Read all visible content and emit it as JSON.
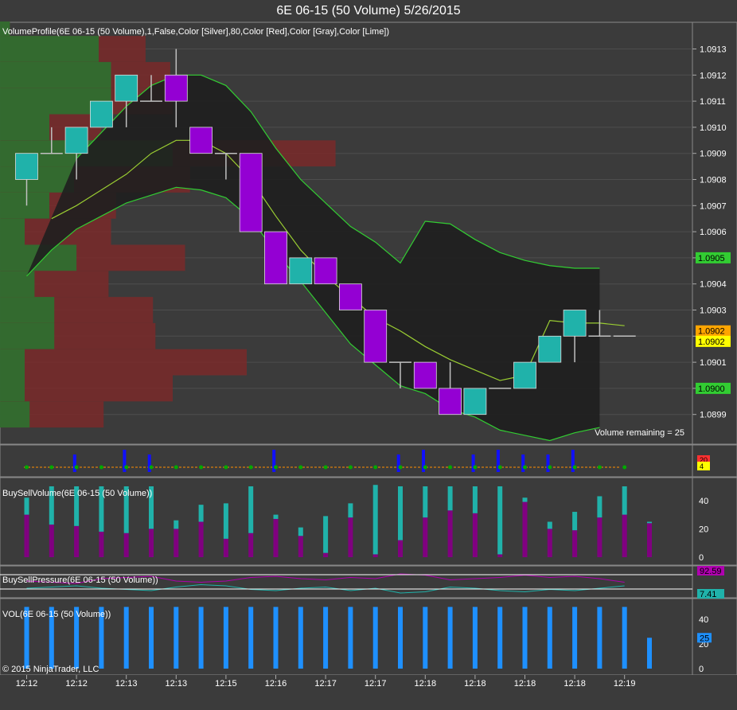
{
  "window_title": "6E 06-15 (50 Volume)  5/26/2015",
  "copyright": "© 2015 NinjaTrader, LLC",
  "colors": {
    "background": "#3b3b3b",
    "up_bar": "#20b2aa",
    "down_bar": "#9400d3",
    "wick": "#c0c0c0",
    "band_fill": "#1f1f1f",
    "band_line": "#32cd32",
    "profile_buy": "#2f6e2f",
    "profile_sell": "#7a2a2a",
    "buy_volume": "#20b2aa",
    "sell_volume": "#800080",
    "vol_bar": "#1e90ff",
    "pressure_buy": "#20b2aa",
    "pressure_sell": "#b000b0"
  },
  "chart_data": [
    {
      "type": "candlestick",
      "indicator_label": "VolumeProfile(6E 06-15 (50 Volume),1,False,Color [Silver],80,Color [Red],Color [Gray],Color [Lime])",
      "note": "Volume remaining = 25",
      "x": [
        "12:12",
        "12:12",
        "12:12",
        "12:13",
        "12:13",
        "12:13",
        "12:15",
        "12:15",
        "12:16",
        "12:16",
        "12:17",
        "12:17",
        "12:17",
        "12:17",
        "12:18",
        "12:18",
        "12:18",
        "12:18",
        "12:18",
        "12:18",
        "12:18",
        "12:18",
        "12:19",
        "12:19",
        "12:19"
      ],
      "x_tick_labels": [
        "12:12",
        "12:12",
        "12:13",
        "12:13",
        "12:15",
        "12:16",
        "12:17",
        "12:17",
        "12:18",
        "12:18",
        "12:18",
        "12:18",
        "12:19"
      ],
      "open": [
        1.0908,
        1.0909,
        1.0909,
        1.091,
        1.0911,
        1.0911,
        1.0912,
        1.091,
        1.0909,
        1.0909,
        1.0906,
        1.0904,
        1.0905,
        1.0904,
        1.0903,
        1.0901,
        1.0901,
        1.09,
        1.0899,
        1.09,
        1.09,
        1.0901,
        1.0902,
        1.0902,
        1.0902
      ],
      "high": [
        1.0909,
        1.091,
        1.091,
        1.0911,
        1.0912,
        1.0912,
        1.0913,
        1.091,
        1.0909,
        1.0909,
        1.0906,
        1.0905,
        1.0905,
        1.0904,
        1.0903,
        1.0901,
        1.0901,
        1.0901,
        1.09,
        1.09,
        1.0901,
        1.0902,
        1.0903,
        1.0903,
        1.0902
      ],
      "low": [
        1.0907,
        1.0909,
        1.0908,
        1.091,
        1.091,
        1.0911,
        1.091,
        1.0909,
        1.0908,
        1.0906,
        1.0904,
        1.0904,
        1.0904,
        1.0903,
        1.0901,
        1.09,
        1.09,
        1.0899,
        1.0899,
        1.09,
        1.09,
        1.0901,
        1.0901,
        1.0902,
        1.0902
      ],
      "close": [
        1.0909,
        1.0909,
        1.091,
        1.0911,
        1.0912,
        1.0911,
        1.0911,
        1.0909,
        1.0909,
        1.0906,
        1.0904,
        1.0905,
        1.0904,
        1.0903,
        1.0901,
        1.0901,
        1.09,
        1.0899,
        1.09,
        1.09,
        1.0901,
        1.0902,
        1.0903,
        1.0902,
        1.0902
      ],
      "band_upper": [
        null,
        null,
        1.09088,
        1.09098,
        1.09108,
        1.09116,
        1.0912,
        1.0912,
        1.09116,
        1.09106,
        1.09092,
        1.0908,
        1.09071,
        1.09062,
        1.09056,
        1.09048,
        1.09064,
        1.09063,
        1.09057,
        1.09052,
        1.09049,
        1.09047,
        1.09046,
        1.09046,
        null
      ],
      "band_middle": [
        null,
        1.09065,
        1.0907,
        1.09076,
        1.09082,
        1.0909,
        1.09095,
        1.09095,
        1.0909,
        1.0908,
        1.09066,
        1.09053,
        1.09043,
        1.09035,
        1.09027,
        1.09022,
        1.09016,
        1.09011,
        1.09007,
        1.09003,
        1.09005,
        1.09026,
        1.09025,
        1.09025,
        1.09024
      ],
      "band_lower": [
        1.09043,
        1.09053,
        1.09061,
        1.09066,
        1.09071,
        1.09074,
        1.09077,
        1.09076,
        1.09073,
        1.09065,
        1.09052,
        1.09041,
        1.09029,
        1.09017,
        1.09009,
        1.09001,
        1.08998,
        1.08992,
        1.08989,
        1.08984,
        1.08982,
        1.0898,
        1.08983,
        1.08985,
        null
      ],
      "price_ticks": [
        1.0913,
        1.0912,
        1.0911,
        1.091,
        1.0909,
        1.0908,
        1.0907,
        1.0906,
        1.0905,
        1.0904,
        1.0903,
        1.0902,
        1.0901,
        1.09,
        1.0899
      ],
      "price_badges": [
        {
          "label": "1.0905",
          "value": 1.0905,
          "color": "#32cd32"
        },
        {
          "label": "1.0902",
          "value": 1.09022,
          "color": "#ffa500"
        },
        {
          "label": "1.0902",
          "value": 1.09018,
          "color": "#ffff00"
        },
        {
          "label": "1.0900",
          "value": 1.09,
          "color": "#32cd32"
        }
      ],
      "volume_profile": {
        "price_levels": [
          1.0914,
          1.0913,
          1.0912,
          1.0911,
          1.091,
          1.0909,
          1.0908,
          1.0907,
          1.0906,
          1.0905,
          1.0904,
          1.0903,
          1.0902,
          1.0901,
          1.09,
          1.0899
        ],
        "buy": [
          4,
          40,
          45,
          45,
          20,
          70,
          30,
          20,
          10,
          31,
          14,
          22,
          22,
          10,
          10,
          12
        ],
        "sell": [
          0,
          19,
          24,
          25,
          21,
          66,
          47,
          27,
          35,
          44,
          30,
          40,
          41,
          90,
          60,
          30
        ]
      }
    },
    {
      "type": "bar",
      "panel": "pressure-dots",
      "badges": [
        {
          "label": "20",
          "color": "#ff3030"
        },
        {
          "label": "4",
          "color": "#ffff00"
        }
      ]
    },
    {
      "type": "bar",
      "title": "BuySellVolume(6E 06-15 (50 Volume))",
      "y_ticks": [
        0,
        20,
        40
      ],
      "ylim": [
        0,
        55
      ],
      "series": [
        {
          "values": [
            30,
            23,
            22,
            18,
            17,
            20,
            20,
            25,
            13,
            17,
            27,
            15,
            3,
            28,
            2,
            12,
            28,
            33,
            31,
            2,
            39,
            20,
            19,
            28,
            30,
            24
          ]
        },
        {
          "values": [
            12,
            27,
            28,
            32,
            33,
            30,
            6,
            12,
            25,
            33,
            3,
            6,
            26,
            10,
            49,
            38,
            22,
            17,
            19,
            48,
            3,
            5,
            13,
            15,
            20,
            1
          ]
        }
      ]
    },
    {
      "type": "line",
      "title": "BuySellPressure(6E 06-15 (50 Volume))",
      "badges": [
        {
          "label": "92.59",
          "color": "#b000b0"
        },
        {
          "label": "7.41",
          "color": "#20b2aa"
        }
      ],
      "series": [
        {
          "values": [
            30,
            35,
            40,
            30,
            25,
            20,
            35,
            45,
            40,
            25,
            20,
            30,
            35,
            20,
            30,
            10,
            15,
            35,
            30,
            20,
            15,
            25,
            20,
            30,
            40
          ]
        },
        {
          "values": [
            60,
            55,
            50,
            70,
            75,
            80,
            60,
            55,
            60,
            75,
            80,
            70,
            65,
            75,
            70,
            90,
            85,
            65,
            70,
            75,
            85,
            75,
            80,
            70,
            55
          ]
        }
      ]
    },
    {
      "type": "bar",
      "title": "VOL(6E 06-15 (50 Volume))",
      "y_ticks": [
        0,
        20,
        40
      ],
      "ylim": [
        0,
        55
      ],
      "badges": [
        {
          "label": "25",
          "color": "#1e90ff"
        }
      ],
      "values": [
        50,
        50,
        50,
        50,
        50,
        50,
        50,
        50,
        50,
        50,
        50,
        50,
        50,
        50,
        50,
        50,
        50,
        50,
        50,
        50,
        50,
        50,
        50,
        50,
        50,
        25
      ]
    }
  ]
}
